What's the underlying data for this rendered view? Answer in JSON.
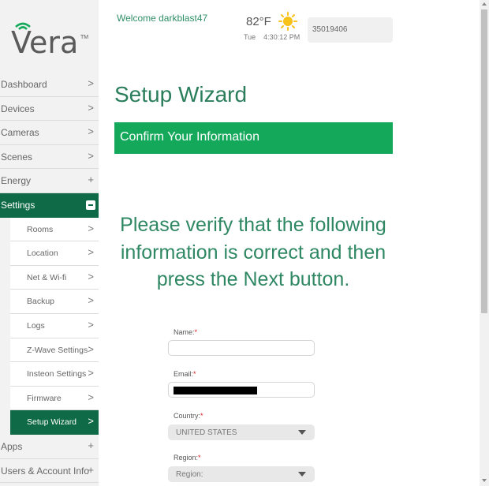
{
  "brand": {
    "logo_text": "Vera",
    "tm": "TM"
  },
  "header": {
    "welcome": "Welcome darkblast47",
    "temperature": "82°F",
    "weather_icon": "sun-icon",
    "date_time": "Tue    4:30:12 PM",
    "serial": "35019406"
  },
  "sidebar": {
    "items": [
      {
        "label": "Dashboard",
        "icon": ">"
      },
      {
        "label": "Devices",
        "icon": ">"
      },
      {
        "label": "Cameras",
        "icon": ">"
      },
      {
        "label": "Scenes",
        "icon": ">"
      },
      {
        "label": "Energy",
        "icon": "+"
      },
      {
        "label": "Settings",
        "icon": "minus-box"
      }
    ],
    "sub_items": [
      {
        "label": "Rooms"
      },
      {
        "label": "Location"
      },
      {
        "label": "Net & Wi-fi"
      },
      {
        "label": "Backup"
      },
      {
        "label": "Logs"
      },
      {
        "label": "Z-Wave Settings"
      },
      {
        "label": "Insteon Settings"
      },
      {
        "label": "Firmware"
      },
      {
        "label": "Setup Wizard"
      }
    ],
    "bottom_items": [
      {
        "label": "Apps",
        "icon": "+"
      },
      {
        "label": "Users & Account Info",
        "icon": "+"
      }
    ],
    "chevron": ">",
    "plus": "+"
  },
  "main": {
    "title": "Setup Wizard",
    "banner": "Confirm Your Information",
    "instructions_line1": "Please verify that the following",
    "instructions_line2": "information is correct and then",
    "instructions_line3": "press the Next button.",
    "form": {
      "name_label": "Name:",
      "name_value": "",
      "email_label": "Email:",
      "country_label": "Country:",
      "country_value": "UNITED STATES",
      "region_label": "Region:",
      "region_value": "Region:",
      "required_mark": "*"
    }
  },
  "colors": {
    "brand_green": "#0f6b47",
    "banner_green": "#13a85a",
    "text_green": "#2a7e5b"
  }
}
